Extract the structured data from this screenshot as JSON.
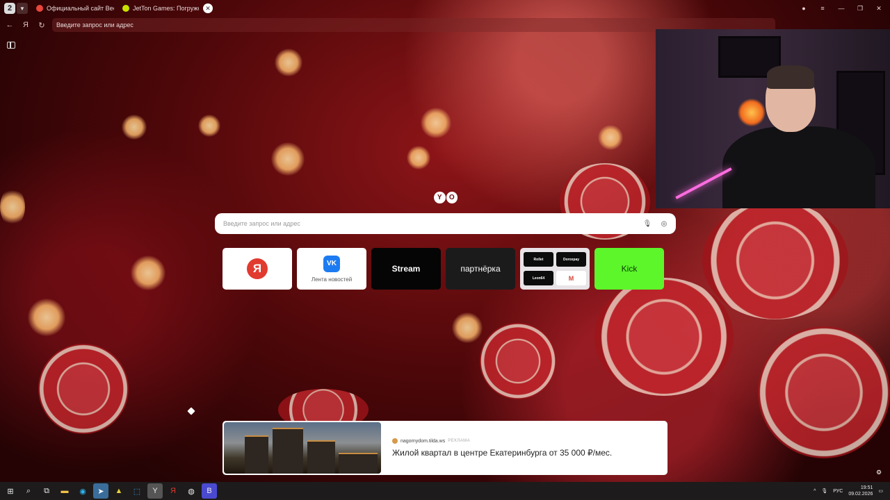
{
  "browser": {
    "tab_count": "2",
    "tabs": [
      {
        "title": "Официальный сайт Beef",
        "color": "#e8453c"
      },
      {
        "title": "JetTon Games: Погружен",
        "color": "#c8e000"
      }
    ],
    "address_placeholder": "Введите запрос или адрес"
  },
  "newtab": {
    "logo_letters": [
      "Y",
      "O"
    ],
    "search_placeholder": "Введите запрос или адрес",
    "tiles": {
      "yandex_letter": "Я",
      "vk_letters": "VK",
      "vk_label": "Лента новостей",
      "stream": "Stream",
      "partner": "партнёрка",
      "group": [
        "Rollet",
        "Doroxpay",
        "Leon64",
        "M"
      ],
      "kick": "Kick"
    }
  },
  "ad": {
    "source": "nagornydom.tilda.ws",
    "tag": "РЕКЛАМА",
    "title": "Жилой квартал в центре Екатеринбурга от 35 000 ₽/мес."
  },
  "taskbar": {
    "lang": "РУС",
    "time": "19:51",
    "date": "09.02.2026"
  },
  "colors": {
    "kick": "#5cf62a",
    "stream_bg": "#050505",
    "partner_bg": "#1b1b1b"
  }
}
